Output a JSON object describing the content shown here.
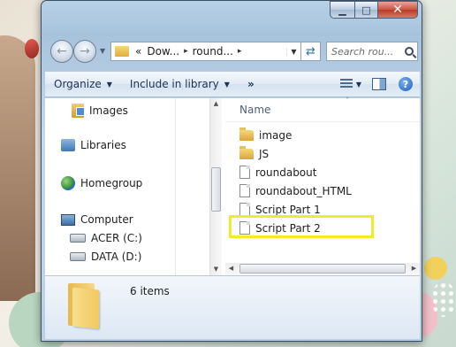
{
  "window": {
    "caption_buttons": {
      "minimize_icon": "minimize-icon",
      "maximize_icon": "maximize-icon",
      "close_icon": "close-icon"
    }
  },
  "nav": {
    "back_glyph": "←",
    "forward_glyph": "→",
    "address": {
      "overflow": "«",
      "segments": [
        "Dow...",
        "round..."
      ],
      "separator": "▸"
    },
    "search_placeholder": "Search rou..."
  },
  "commands": {
    "organize": "Organize",
    "include_in_library": "Include in library",
    "more": "»",
    "help": "?"
  },
  "navpane": {
    "items": [
      {
        "label": "Images",
        "icon": "images-library-icon"
      },
      {
        "label": "Libraries",
        "icon": "libraries-icon"
      },
      {
        "label": "Homegroup",
        "icon": "homegroup-icon"
      },
      {
        "label": "Computer",
        "icon": "computer-icon"
      },
      {
        "label": "ACER (C:)",
        "icon": "drive-icon"
      },
      {
        "label": "DATA (D:)",
        "icon": "drive-icon"
      }
    ]
  },
  "filelist": {
    "column_name": "Name",
    "items": [
      {
        "name": "image",
        "type": "folder"
      },
      {
        "name": "JS",
        "type": "folder"
      },
      {
        "name": "roundabout",
        "type": "file"
      },
      {
        "name": "roundabout_HTML",
        "type": "file"
      },
      {
        "name": "Script Part 1",
        "type": "file"
      },
      {
        "name": "Script Part 2",
        "type": "file",
        "highlighted": true
      }
    ],
    "highlight_color": "#f3ea2a"
  },
  "details": {
    "item_count": "6 items"
  },
  "colors": {
    "accent": "#2f6db3",
    "command_text": "#1e3150"
  }
}
